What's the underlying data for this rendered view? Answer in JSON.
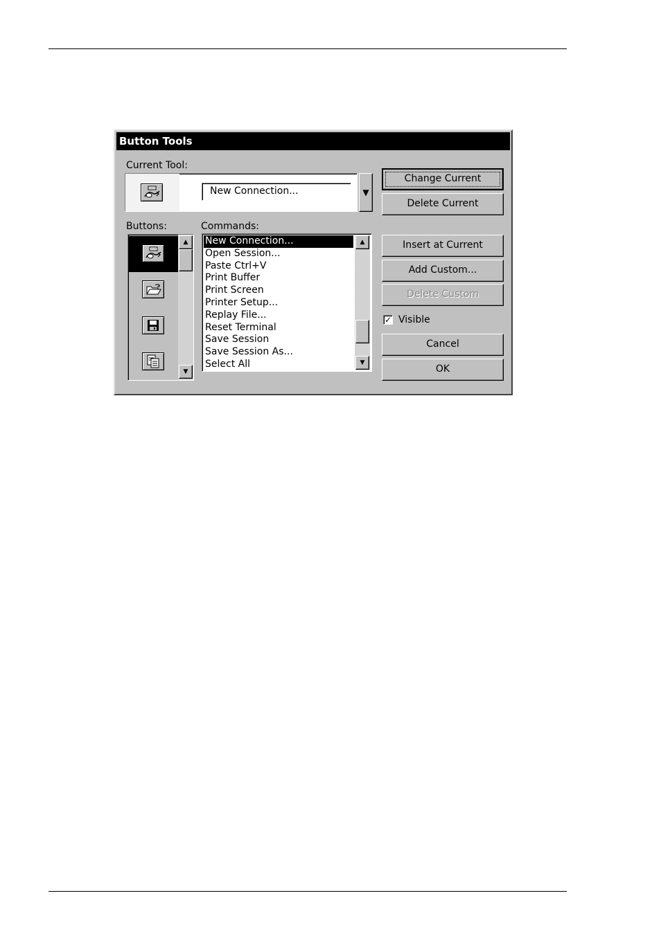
{
  "dialog": {
    "title": "Button Tools"
  },
  "current_tool": {
    "label": "Current Tool:",
    "icon": "new-connection-icon",
    "value": "New Connection..."
  },
  "buttons_list": {
    "label": "Buttons:",
    "items": [
      {
        "icon": "new-connection-icon",
        "selected": true
      },
      {
        "icon": "open-folder-icon",
        "selected": false
      },
      {
        "icon": "floppy-disk-icon",
        "selected": false
      },
      {
        "icon": "paste-icon",
        "selected": false
      }
    ]
  },
  "commands_list": {
    "label": "Commands:",
    "items": [
      "New Connection...",
      "Open Session...",
      "Paste  Ctrl+V",
      "Print Buffer",
      "Print Screen",
      "Printer Setup...",
      "Replay File...",
      "Reset Terminal",
      "Save Session",
      "Save Session As...",
      "Select All"
    ],
    "selected_index": 0
  },
  "actions": {
    "change_current": "Change Current",
    "delete_current": "Delete Current",
    "insert_at_current": "Insert at Current",
    "add_custom": "Add Custom...",
    "delete_custom": "Delete Custom",
    "visible_label": "Visible",
    "visible_checked": true,
    "cancel": "Cancel",
    "ok": "OK"
  }
}
